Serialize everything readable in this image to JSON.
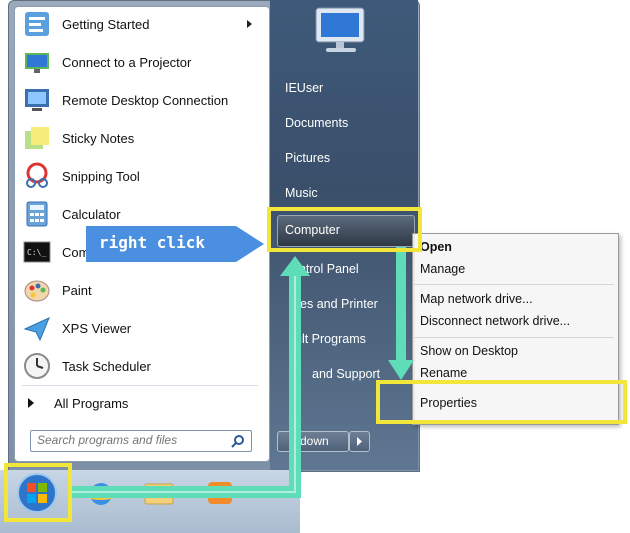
{
  "start_menu": {
    "programs": [
      {
        "label": "Getting Started",
        "icon": "getting-started-icon",
        "submenu": true
      },
      {
        "label": "Connect to a Projector",
        "icon": "projector-icon"
      },
      {
        "label": "Remote Desktop Connection",
        "icon": "remote-desktop-icon"
      },
      {
        "label": "Sticky Notes",
        "icon": "sticky-notes-icon"
      },
      {
        "label": "Snipping Tool",
        "icon": "scissors-icon"
      },
      {
        "label": "Calculator",
        "icon": "calculator-icon"
      },
      {
        "label": "Com",
        "icon": "command-prompt-icon"
      },
      {
        "label": "Paint",
        "icon": "paint-palette-icon"
      },
      {
        "label": "XPS Viewer",
        "icon": "xps-viewer-icon"
      },
      {
        "label": "Task Scheduler",
        "icon": "clock-icon"
      }
    ],
    "all_programs": "All Programs",
    "search_placeholder": "Search programs and files",
    "right_links": [
      "IEUser",
      "Documents",
      "Pictures",
      "Music",
      "Computer",
      "ontrol Panel",
      "ices and Printer",
      "ult Programs",
      "and Support"
    ],
    "shutdown_label": "down"
  },
  "context_menu": {
    "items": [
      "Open",
      "Manage",
      "Map network drive...",
      "Disconnect network drive...",
      "Show on Desktop",
      "Rename",
      "Properties"
    ]
  },
  "annotation": {
    "callout": "right click",
    "highlight_color": "#f2e63a",
    "arrow_color": "#5fdcb8",
    "callout_color": "#4b8fe0"
  }
}
